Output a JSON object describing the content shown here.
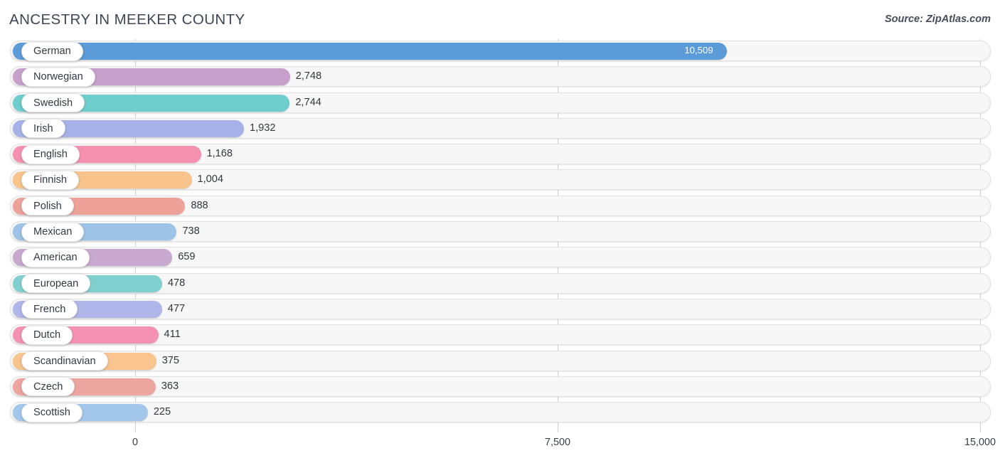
{
  "header": {
    "title": "ANCESTRY IN MEEKER COUNTY",
    "source": "Source: ZipAtlas.com"
  },
  "chart_data": {
    "type": "bar",
    "orientation": "horizontal",
    "title": "ANCESTRY IN MEEKER COUNTY",
    "subtitle": "",
    "xlabel": "",
    "ylabel": "",
    "xlim": [
      0,
      15000
    ],
    "grid": true,
    "legend": null,
    "ticks": [
      "0",
      "7,500",
      "15,000"
    ],
    "tick_values": [
      0,
      7500,
      15000
    ],
    "categories": [
      "German",
      "Norwegian",
      "Swedish",
      "Irish",
      "English",
      "Finnish",
      "Polish",
      "Mexican",
      "American",
      "European",
      "French",
      "Dutch",
      "Scandinavian",
      "Czech",
      "Scottish"
    ],
    "values": [
      10509,
      2748,
      2744,
      1932,
      1168,
      1004,
      888,
      738,
      659,
      478,
      477,
      411,
      375,
      363,
      225
    ],
    "value_labels": [
      "10,509",
      "2,748",
      "2,744",
      "1,932",
      "1,168",
      "1,004",
      "888",
      "738",
      "659",
      "478",
      "477",
      "411",
      "375",
      "363",
      "225"
    ],
    "colors": [
      "#5b9bd8",
      "#c79fcb",
      "#6ecdcd",
      "#a6b1e8",
      "#f590ae",
      "#f9c48b",
      "#eda199",
      "#9dc3e6",
      "#c9a8cf",
      "#81d0d0",
      "#aeb6ea",
      "#f591b3",
      "#f9c48d",
      "#eda5a0",
      "#a2c7ea"
    ],
    "rows": [
      {
        "label": "German",
        "value": 10509,
        "value_label": "10,509",
        "color": "#5b9bd8",
        "label_inside": true
      },
      {
        "label": "Norwegian",
        "value": 2748,
        "value_label": "2,748",
        "color": "#c79fcb",
        "label_inside": false
      },
      {
        "label": "Swedish",
        "value": 2744,
        "value_label": "2,744",
        "color": "#6ecdcd",
        "label_inside": false
      },
      {
        "label": "Irish",
        "value": 1932,
        "value_label": "1,932",
        "color": "#a6b1e8",
        "label_inside": false
      },
      {
        "label": "English",
        "value": 1168,
        "value_label": "1,168",
        "color": "#f590ae",
        "label_inside": false
      },
      {
        "label": "Finnish",
        "value": 1004,
        "value_label": "1,004",
        "color": "#f9c48b",
        "label_inside": false
      },
      {
        "label": "Polish",
        "value": 888,
        "value_label": "888",
        "color": "#eda199",
        "label_inside": false
      },
      {
        "label": "Mexican",
        "value": 738,
        "value_label": "738",
        "color": "#9dc3e6",
        "label_inside": false
      },
      {
        "label": "American",
        "value": 659,
        "value_label": "659",
        "color": "#c9a8cf",
        "label_inside": false
      },
      {
        "label": "European",
        "value": 478,
        "value_label": "478",
        "color": "#81d0d0",
        "label_inside": false
      },
      {
        "label": "French",
        "value": 477,
        "value_label": "477",
        "color": "#aeb6ea",
        "label_inside": false
      },
      {
        "label": "Dutch",
        "value": 411,
        "value_label": "411",
        "color": "#f591b3",
        "label_inside": false
      },
      {
        "label": "Scandinavian",
        "value": 375,
        "value_label": "375",
        "color": "#f9c48d",
        "label_inside": false
      },
      {
        "label": "Czech",
        "value": 363,
        "value_label": "363",
        "color": "#eda5a0",
        "label_inside": false
      },
      {
        "label": "Scottish",
        "value": 225,
        "value_label": "225",
        "color": "#a2c7ea",
        "label_inside": false
      }
    ]
  }
}
